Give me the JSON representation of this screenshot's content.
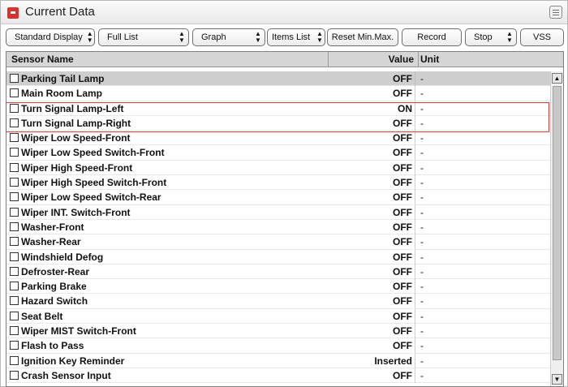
{
  "panel": {
    "title": "Current Data"
  },
  "toolbar": {
    "display_mode": "Standard Display",
    "list_mode": "Full List",
    "graph_mode": "Graph",
    "items_list": "Items List",
    "reset_label": "Reset Min.Max.",
    "record_label": "Record",
    "stop_label": "Stop",
    "vss_label": "VSS"
  },
  "table": {
    "headers": {
      "name": "Sensor Name",
      "value": "Value",
      "unit": "Unit"
    },
    "rows": [
      {
        "name": "Parking Tail Lamp",
        "value": "OFF",
        "unit": "-"
      },
      {
        "name": "Main Room Lamp",
        "value": "OFF",
        "unit": "-"
      },
      {
        "name": "Turn Signal Lamp-Left",
        "value": "ON",
        "unit": "-"
      },
      {
        "name": "Turn Signal Lamp-Right",
        "value": "OFF",
        "unit": "-"
      },
      {
        "name": "Wiper Low Speed-Front",
        "value": "OFF",
        "unit": "-"
      },
      {
        "name": "Wiper Low Speed Switch-Front",
        "value": "OFF",
        "unit": "-"
      },
      {
        "name": "Wiper High Speed-Front",
        "value": "OFF",
        "unit": "-"
      },
      {
        "name": "Wiper High Speed Switch-Front",
        "value": "OFF",
        "unit": "-"
      },
      {
        "name": "Wiper Low Speed Switch-Rear",
        "value": "OFF",
        "unit": "-"
      },
      {
        "name": "Wiper INT. Switch-Front",
        "value": "OFF",
        "unit": "-"
      },
      {
        "name": "Washer-Front",
        "value": "OFF",
        "unit": "-"
      },
      {
        "name": "Washer-Rear",
        "value": "OFF",
        "unit": "-"
      },
      {
        "name": "Windshield Defog",
        "value": "OFF",
        "unit": "-"
      },
      {
        "name": "Defroster-Rear",
        "value": "OFF",
        "unit": "-"
      },
      {
        "name": "Parking Brake",
        "value": "OFF",
        "unit": "-"
      },
      {
        "name": "Hazard Switch",
        "value": "OFF",
        "unit": "-"
      },
      {
        "name": "Seat Belt",
        "value": "OFF",
        "unit": "-"
      },
      {
        "name": "Wiper MIST Switch-Front",
        "value": "OFF",
        "unit": "-"
      },
      {
        "name": "Flash to Pass",
        "value": "OFF",
        "unit": "-"
      },
      {
        "name": "Ignition Key Reminder",
        "value": "Inserted",
        "unit": "-"
      },
      {
        "name": "Crash Sensor Input",
        "value": "OFF",
        "unit": "-"
      }
    ]
  },
  "colors": {
    "highlight": "#e23b3b",
    "collapse_icon": "#d8322c"
  },
  "icons": {
    "collapse": "collapse-icon",
    "menu": "menu-icon",
    "sort_arrows": "updown-arrows-icon"
  }
}
